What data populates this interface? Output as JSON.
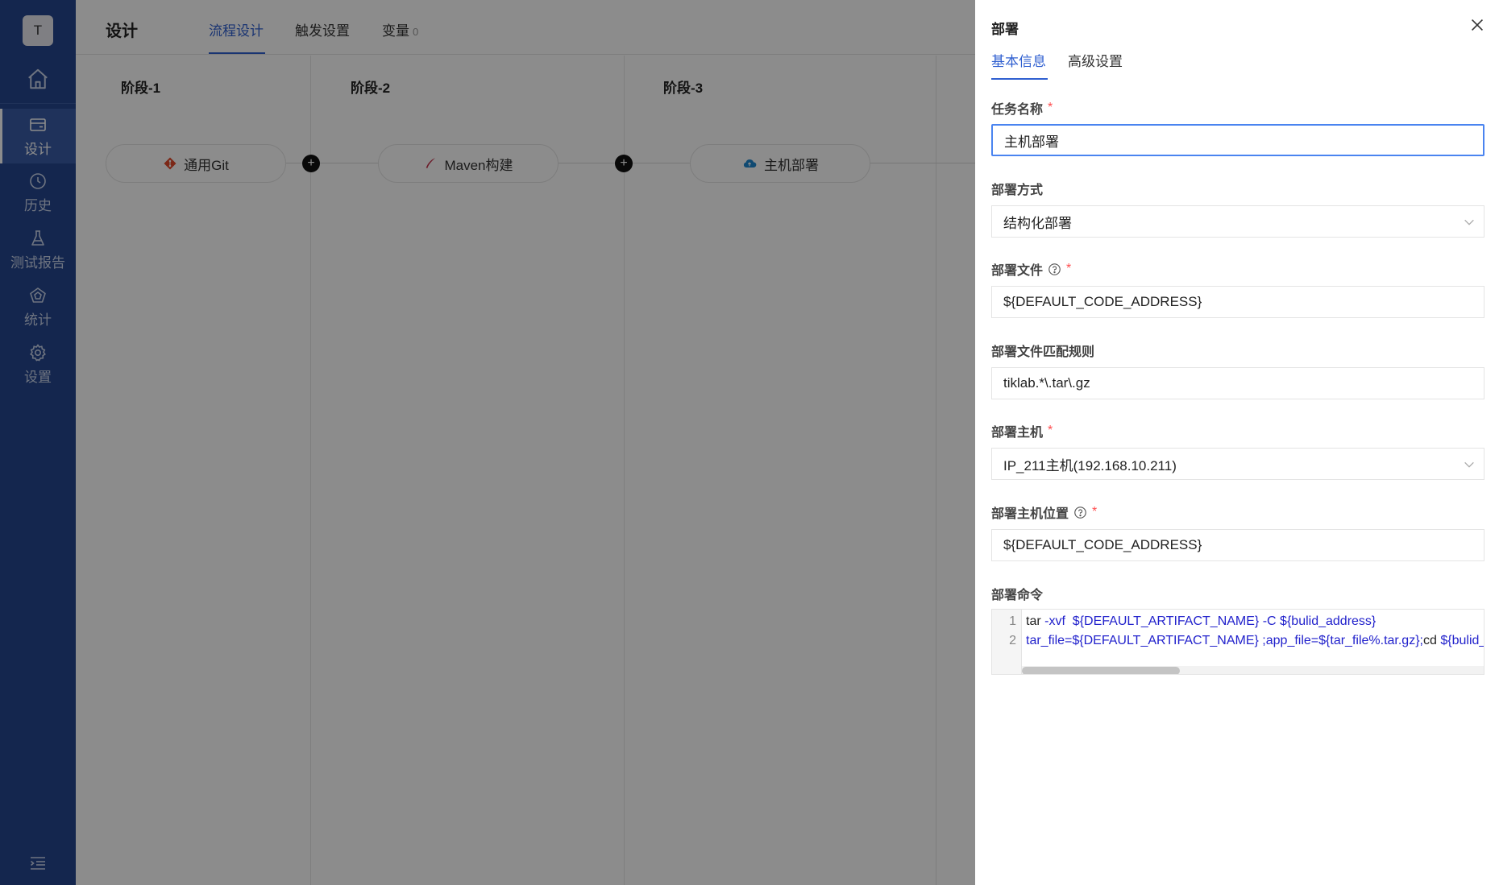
{
  "sidebar": {
    "avatar_letter": "T",
    "items": [
      {
        "label": "设计",
        "icon": "design-icon"
      },
      {
        "label": "历史",
        "icon": "clock-icon"
      },
      {
        "label": "测试报告",
        "icon": "flask-icon"
      },
      {
        "label": "统计",
        "icon": "chart-icon"
      },
      {
        "label": "设置",
        "icon": "gear-icon"
      }
    ]
  },
  "header": {
    "title": "设计",
    "tabs": [
      {
        "label": "流程设计"
      },
      {
        "label": "触发设置"
      },
      {
        "label": "变量",
        "count": "0"
      }
    ]
  },
  "pipeline": {
    "stages": [
      {
        "title": "阶段-1",
        "task": "通用Git"
      },
      {
        "title": "阶段-2",
        "task": "Maven构建"
      },
      {
        "title": "阶段-3",
        "task": "主机部署"
      }
    ]
  },
  "drawer": {
    "title": "部署",
    "tabs": [
      "基本信息",
      "高级设置"
    ],
    "fields": {
      "task_name": {
        "label": "任务名称",
        "value": "主机部署"
      },
      "deploy_mode": {
        "label": "部署方式",
        "value": "结构化部署"
      },
      "deploy_file": {
        "label": "部署文件",
        "value": "${DEFAULT_CODE_ADDRESS}"
      },
      "match_rule": {
        "label": "部署文件匹配规则",
        "value": "tiklab.*\\.tar\\.gz"
      },
      "host": {
        "label": "部署主机",
        "value": "IP_211主机(192.168.10.211)"
      },
      "host_location": {
        "label": "部署主机位置",
        "value": "${DEFAULT_CODE_ADDRESS}"
      },
      "command": {
        "label": "部署命令",
        "line_numbers": [
          "1",
          "2"
        ],
        "line1_a": "tar ",
        "line1_b": "-xvf  ${DEFAULT_ARTIFACT_NAME} -C ${bulid_address}",
        "line2_a": "tar_file=${DEFAULT_ARTIFACT_NAME} ;app_file=${tar_file%.tar.gz};",
        "line2_b": "cd ",
        "line2_c": "${bulid_address}/${app_file}"
      }
    },
    "required_mark": "*"
  },
  "colors": {
    "sidebar_bg": "#25468e",
    "accent": "#2f5fd0",
    "required": "#ff4d4f"
  }
}
